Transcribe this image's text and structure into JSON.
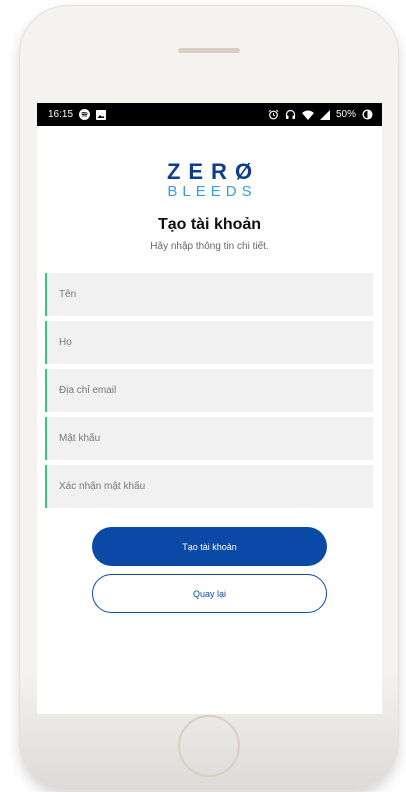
{
  "status_bar": {
    "time": "16:15",
    "battery": "50%",
    "icons": [
      "spotify-icon",
      "image-icon",
      "alarm-icon",
      "headset-icon",
      "wifi-icon",
      "signal-icon",
      "battery-icon"
    ]
  },
  "logo": {
    "line1": "ZERØ",
    "line2": "BLEEDS"
  },
  "form": {
    "title": "Tạo tài khoản",
    "subtitle": "Hãy nhập thông tin chi tiết.",
    "fields": {
      "first_name": "Tên",
      "last_name": "Họ",
      "email": "Địa chỉ email",
      "password": "Mật khẩu",
      "confirm_password": "Xác nhận mật khẩu"
    },
    "create_button": "Tạo tài khoản",
    "back_button": "Quay lại"
  },
  "colors": {
    "primary": "#0a4aa6",
    "accent": "#3cc27a",
    "logo_dark": "#0e3d8a",
    "logo_light": "#3aa0d8"
  }
}
